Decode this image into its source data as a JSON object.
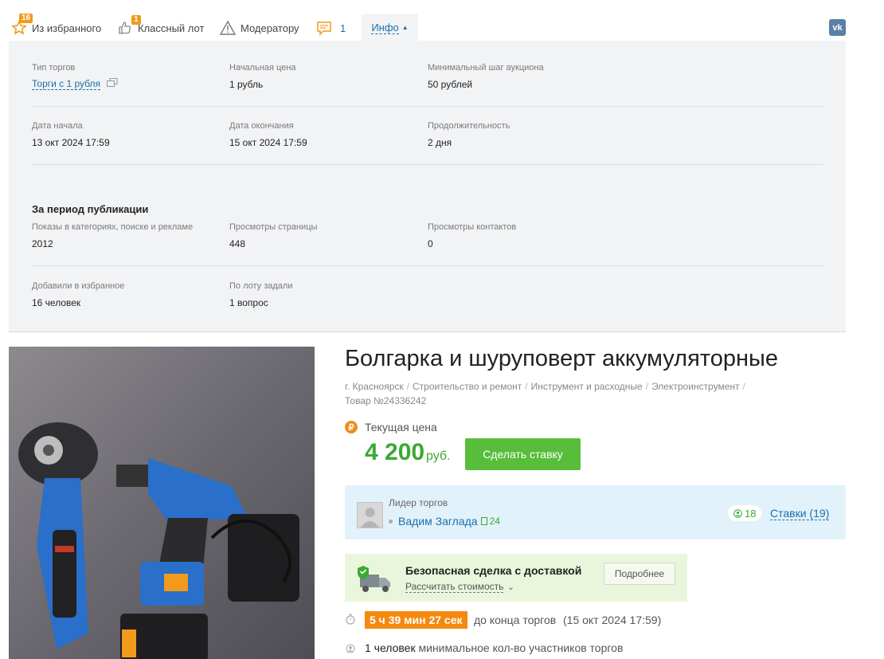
{
  "tabs": {
    "favorites": {
      "label": "Из избранного",
      "badge": "16"
    },
    "classy": {
      "label": "Классный лот",
      "badge": "1"
    },
    "moderator": {
      "label": "Модератору"
    },
    "comments": {
      "label": "1"
    },
    "info": {
      "label": "Инфо"
    }
  },
  "social": {
    "vk": "vk"
  },
  "info": {
    "rows": [
      {
        "label": "Тип торгов",
        "value": "Торги с 1 рубля"
      },
      {
        "label": "Начальная цена",
        "value": "1 рубль"
      },
      {
        "label": "Минимальный шаг аукциона",
        "value": "50 рублей"
      },
      {
        "label": "Дата начала",
        "value": "13 окт 2024 17:59"
      },
      {
        "label": "Дата окончания",
        "value": "15 окт 2024 17:59"
      },
      {
        "label": "Продолжительность",
        "value": "2 дня"
      }
    ],
    "period_title": "За период публикации",
    "stats": [
      {
        "label": "Показы в категориях, поиске и рекламе",
        "value": "2012"
      },
      {
        "label": "Просмотры страницы",
        "value": "448"
      },
      {
        "label": "Просмотры контактов",
        "value": "0"
      },
      {
        "label": "Добавили в избранное",
        "value": "16 человек"
      },
      {
        "label": "По лоту задали",
        "value": "1 вопрос"
      }
    ]
  },
  "product": {
    "title": "Болгарка и шуруповерт аккумуляторные",
    "breadcrumbs": [
      "г. Красноярск",
      "Строительство и ремонт",
      "Инструмент и расходные",
      "Электроинструмент"
    ],
    "item_number": "Товар №24336242",
    "price_label": "Текущая цена",
    "price": "4 200",
    "currency": "руб.",
    "bid_button": "Сделать ставку"
  },
  "leader": {
    "label": "Лидер торгов",
    "name": "Вадим Заглада",
    "rating": "24",
    "participants": "18",
    "bids_link": "Ставки (19)"
  },
  "deal": {
    "title": "Безопасная сделка с доставкой",
    "calc_link": "Рассчитать стоимость",
    "more_button": "Подробнее"
  },
  "timer": {
    "remaining": "5 ч 39 мин 27 сек",
    "suffix": "до конца торгов",
    "end": "(15 окт 2024 17:59)"
  },
  "participants": {
    "count": "1 человек",
    "text": "минимальное кол-во участников торгов"
  },
  "colors": {
    "accent": "#1a6fad",
    "price": "#3aaa35",
    "button": "#58bd3a",
    "timer": "#f5890f"
  }
}
